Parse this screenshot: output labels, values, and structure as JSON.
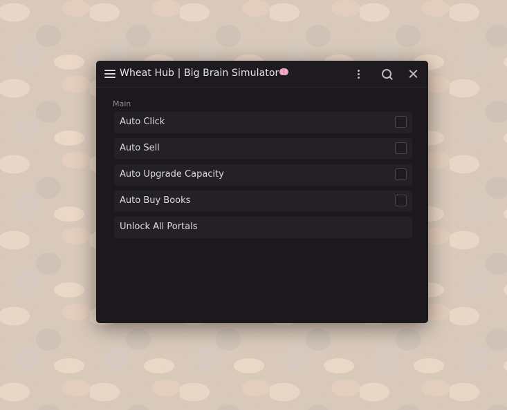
{
  "window": {
    "title": "Wheat Hub | Big Brain Simulator",
    "title_emoji": "brain-icon"
  },
  "toolbar": {
    "menu_icon": "hamburger-menu-icon",
    "more_icon": "vertical-dots-icon",
    "search_icon": "search-icon",
    "close_icon": "close-icon"
  },
  "main": {
    "section_label": "Main",
    "items": [
      {
        "label": "Auto Click",
        "type": "toggle",
        "checked": false
      },
      {
        "label": "Auto Sell",
        "type": "toggle",
        "checked": false
      },
      {
        "label": "Auto Upgrade Capacity",
        "type": "toggle",
        "checked": false
      },
      {
        "label": "Auto Buy Books",
        "type": "toggle",
        "checked": false
      },
      {
        "label": "Unlock All Portals",
        "type": "button"
      }
    ]
  },
  "colors": {
    "window_bg": "#1b191c",
    "row_bg": "#232124",
    "text": "#dcdadc",
    "muted_text": "#8e8b8f"
  }
}
